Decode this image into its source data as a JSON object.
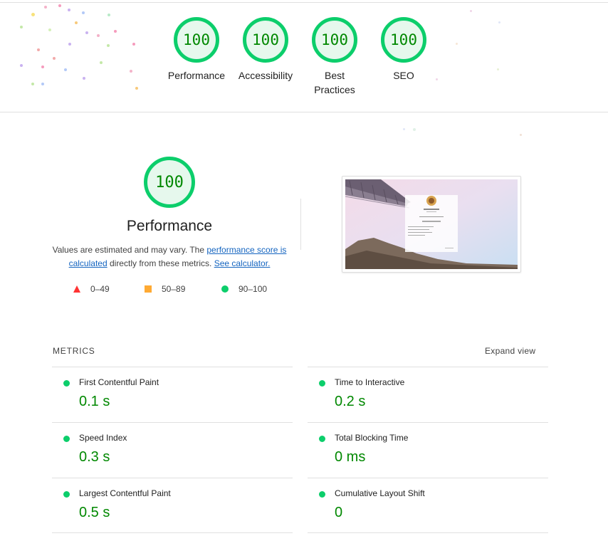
{
  "categories": [
    {
      "score": "100",
      "label": "Performance"
    },
    {
      "score": "100",
      "label": "Accessibility"
    },
    {
      "score": "100",
      "label": "Best Practices"
    },
    {
      "score": "100",
      "label": "SEO"
    }
  ],
  "performance": {
    "score": "100",
    "title": "Performance",
    "desc_prefix": "Values are estimated and may vary. The ",
    "link_score": "performance score is calculated",
    "desc_middle": " directly from these metrics. ",
    "link_calc": "See calculator.",
    "legend": {
      "fail": "0–49",
      "average": "50–89",
      "pass": "90–100"
    },
    "colors": {
      "pass": "#0cce6b",
      "average": "#ffaa33",
      "fail": "#ff3333",
      "score_text": "#008800"
    }
  },
  "metrics": {
    "heading": "METRICS",
    "expand": "Expand view",
    "items": [
      {
        "name": "First Contentful Paint",
        "value": "0.1 s"
      },
      {
        "name": "Time to Interactive",
        "value": "0.2 s"
      },
      {
        "name": "Speed Index",
        "value": "0.3 s"
      },
      {
        "name": "Total Blocking Time",
        "value": "0 ms"
      },
      {
        "name": "Largest Contentful Paint",
        "value": "0.5 s"
      },
      {
        "name": "Cumulative Layout Shift",
        "value": "0"
      }
    ]
  }
}
